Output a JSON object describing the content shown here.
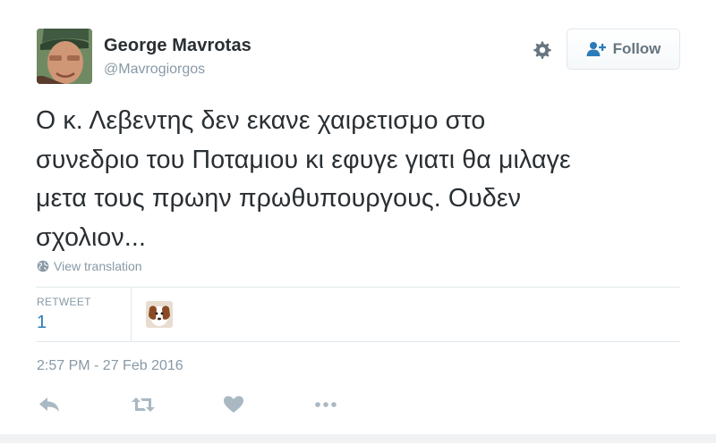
{
  "user": {
    "name": "George Mavrotas",
    "handle": "@Mavrogiorgos"
  },
  "header": {
    "follow_label": "Follow"
  },
  "tweet": {
    "lines": [
      "Ο κ. Λεβεντης δεν εκανε χαιρετισμο στο",
      "συνεδριο του Ποταμιου κι εφυγε γιατι θα μιλαγε",
      "μετα τους πρωην πρωθυπουργους. Ουδεν",
      "σχολιον..."
    ],
    "translate_label": "View translation"
  },
  "stats": {
    "retweet_label": "RETWEET",
    "retweet_count": "1"
  },
  "timestamp": "2:57 PM - 27 Feb 2016",
  "icons": {
    "settings": "gear-icon",
    "follow": "add-user-icon",
    "translate": "globe-icon",
    "reply": "reply-icon",
    "retweet": "retweet-icon",
    "like": "heart-icon",
    "more": "more-dots-icon"
  },
  "colors": {
    "text": "#292f33",
    "muted": "#8899a6",
    "link": "#2b7bb9",
    "follow_icon": "#2b7bb9",
    "action_icon": "#aab8c2",
    "border": "#e1e8ed"
  }
}
